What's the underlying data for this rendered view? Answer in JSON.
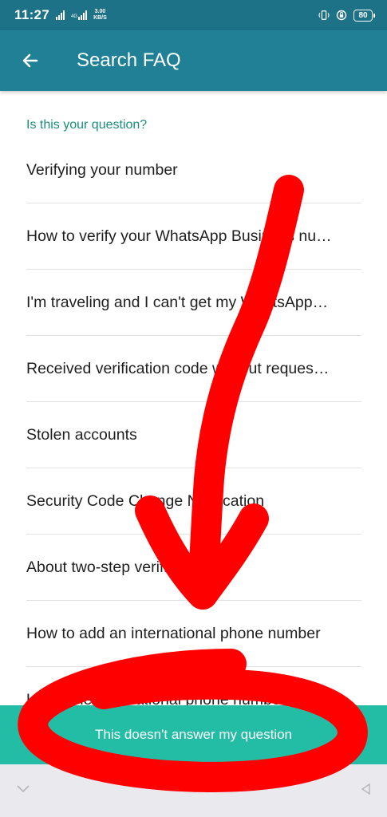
{
  "status_bar": {
    "time": "11:27",
    "network_type": "4G",
    "speed_value": "3.00",
    "speed_unit": "KB/S",
    "battery": "80"
  },
  "header": {
    "title": "Search FAQ"
  },
  "section_label": "Is this your question?",
  "faq_items": [
    "Verifying your number",
    "How to verify your WhatsApp Business nu…",
    "I'm traveling and I can't get my WhatsApp…",
    "Received verification code without reques…",
    "Stolen accounts",
    "Security Code Change Notification",
    "About two-step verification",
    "How to add an international phone number",
    "Using the international phone number form…"
  ],
  "answer_button": "This doesn't answer my question",
  "colors": {
    "status_bar": "#1d7287",
    "app_bar": "#1f8096",
    "accent": "#188f7c",
    "answer_bar": "#23bda6",
    "annotation": "#ff0000"
  }
}
